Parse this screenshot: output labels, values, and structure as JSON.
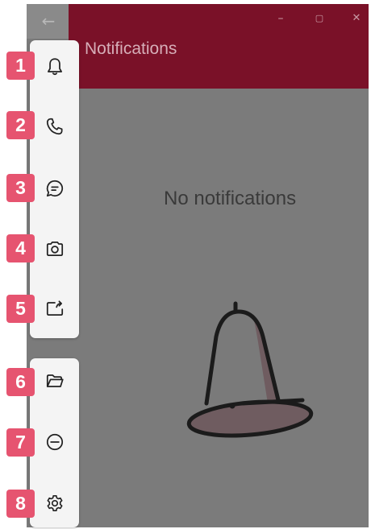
{
  "window": {
    "title": "Notifications",
    "back_glyph": "←",
    "minimize_glyph": "–",
    "maximize_glyph": "▢",
    "close_glyph": "✕",
    "titlebar_color": "#7a1128",
    "content_color": "#7b7b7b"
  },
  "main": {
    "empty_message": "No notifications"
  },
  "nav": {
    "items": [
      {
        "badge": "1",
        "icon": "bell-icon"
      },
      {
        "badge": "2",
        "icon": "phone-icon"
      },
      {
        "badge": "3",
        "icon": "chat-icon"
      },
      {
        "badge": "4",
        "icon": "camera-icon"
      },
      {
        "badge": "5",
        "icon": "screen-share-icon"
      },
      {
        "badge": "6",
        "icon": "folder-icon"
      },
      {
        "badge": "7",
        "icon": "minus-circle-icon"
      },
      {
        "badge": "8",
        "icon": "gear-icon"
      }
    ]
  },
  "badge_color": "#e65470"
}
